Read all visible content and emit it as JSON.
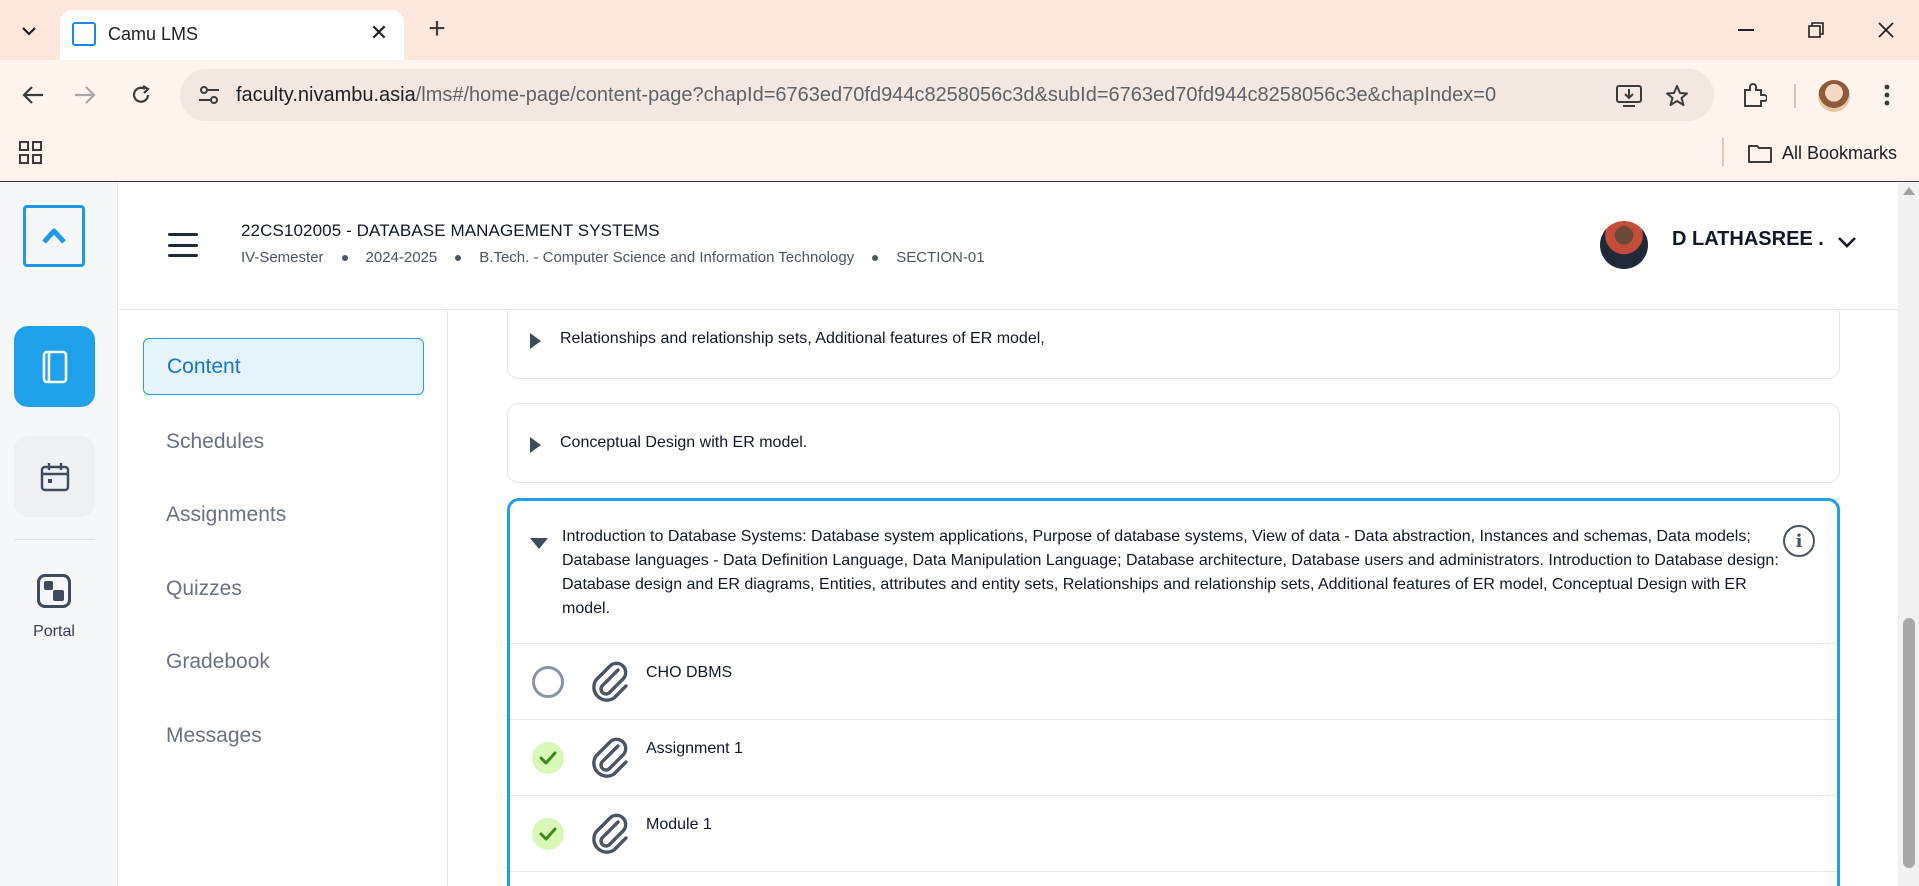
{
  "browser": {
    "tab_title": "Camu LMS",
    "url_host": "faculty.nivambu.asia",
    "url_path": "/lms#/home-page/content-page?chapId=6763ed70fd944c8258056c3d&subId=6763ed70fd944c8258056c3e&chapIndex=0",
    "bookmarks_label": "All Bookmarks"
  },
  "header": {
    "course_title": "22CS102005 - DATABASE MANAGEMENT SYSTEMS",
    "semester": "IV-Semester",
    "year": "2024-2025",
    "program": "B.Tech. - Computer Science and Information Technology",
    "section": "SECTION-01",
    "user_name": "D LATHASREE ."
  },
  "rail": {
    "portal_label": "Portal"
  },
  "menu": {
    "items": [
      {
        "label": "Content"
      },
      {
        "label": "Schedules"
      },
      {
        "label": "Assignments"
      },
      {
        "label": "Quizzes"
      },
      {
        "label": "Gradebook"
      },
      {
        "label": "Messages"
      }
    ]
  },
  "chapters": {
    "collapsed": [
      {
        "title": "Relationships and relationship sets, Additional features of ER model,"
      },
      {
        "title": "Conceptual Design with ER model."
      }
    ],
    "expanded": {
      "description": "Introduction to Database Systems: Database system applications, Purpose of database systems, View of data - Data abstraction, Instances and schemas, Data models; Database languages - Data Definition Language, Data Manipulation Language; Database architecture, Database users and administrators. Introduction to Database design: Database design and ER diagrams, Entities, attributes and entity sets, Relationships and relationship sets, Additional features of ER model, Conceptual Design with ER model.",
      "resources": [
        {
          "label": "CHO DBMS",
          "completed": false
        },
        {
          "label": "Assignment 1",
          "completed": true
        },
        {
          "label": "Module 1",
          "completed": true
        }
      ]
    }
  },
  "colors": {
    "accent": "#1ea1e8",
    "tab_strip": "#fde6dc",
    "done_badge": "#d9f8b8",
    "done_check": "#3a8a1c"
  }
}
